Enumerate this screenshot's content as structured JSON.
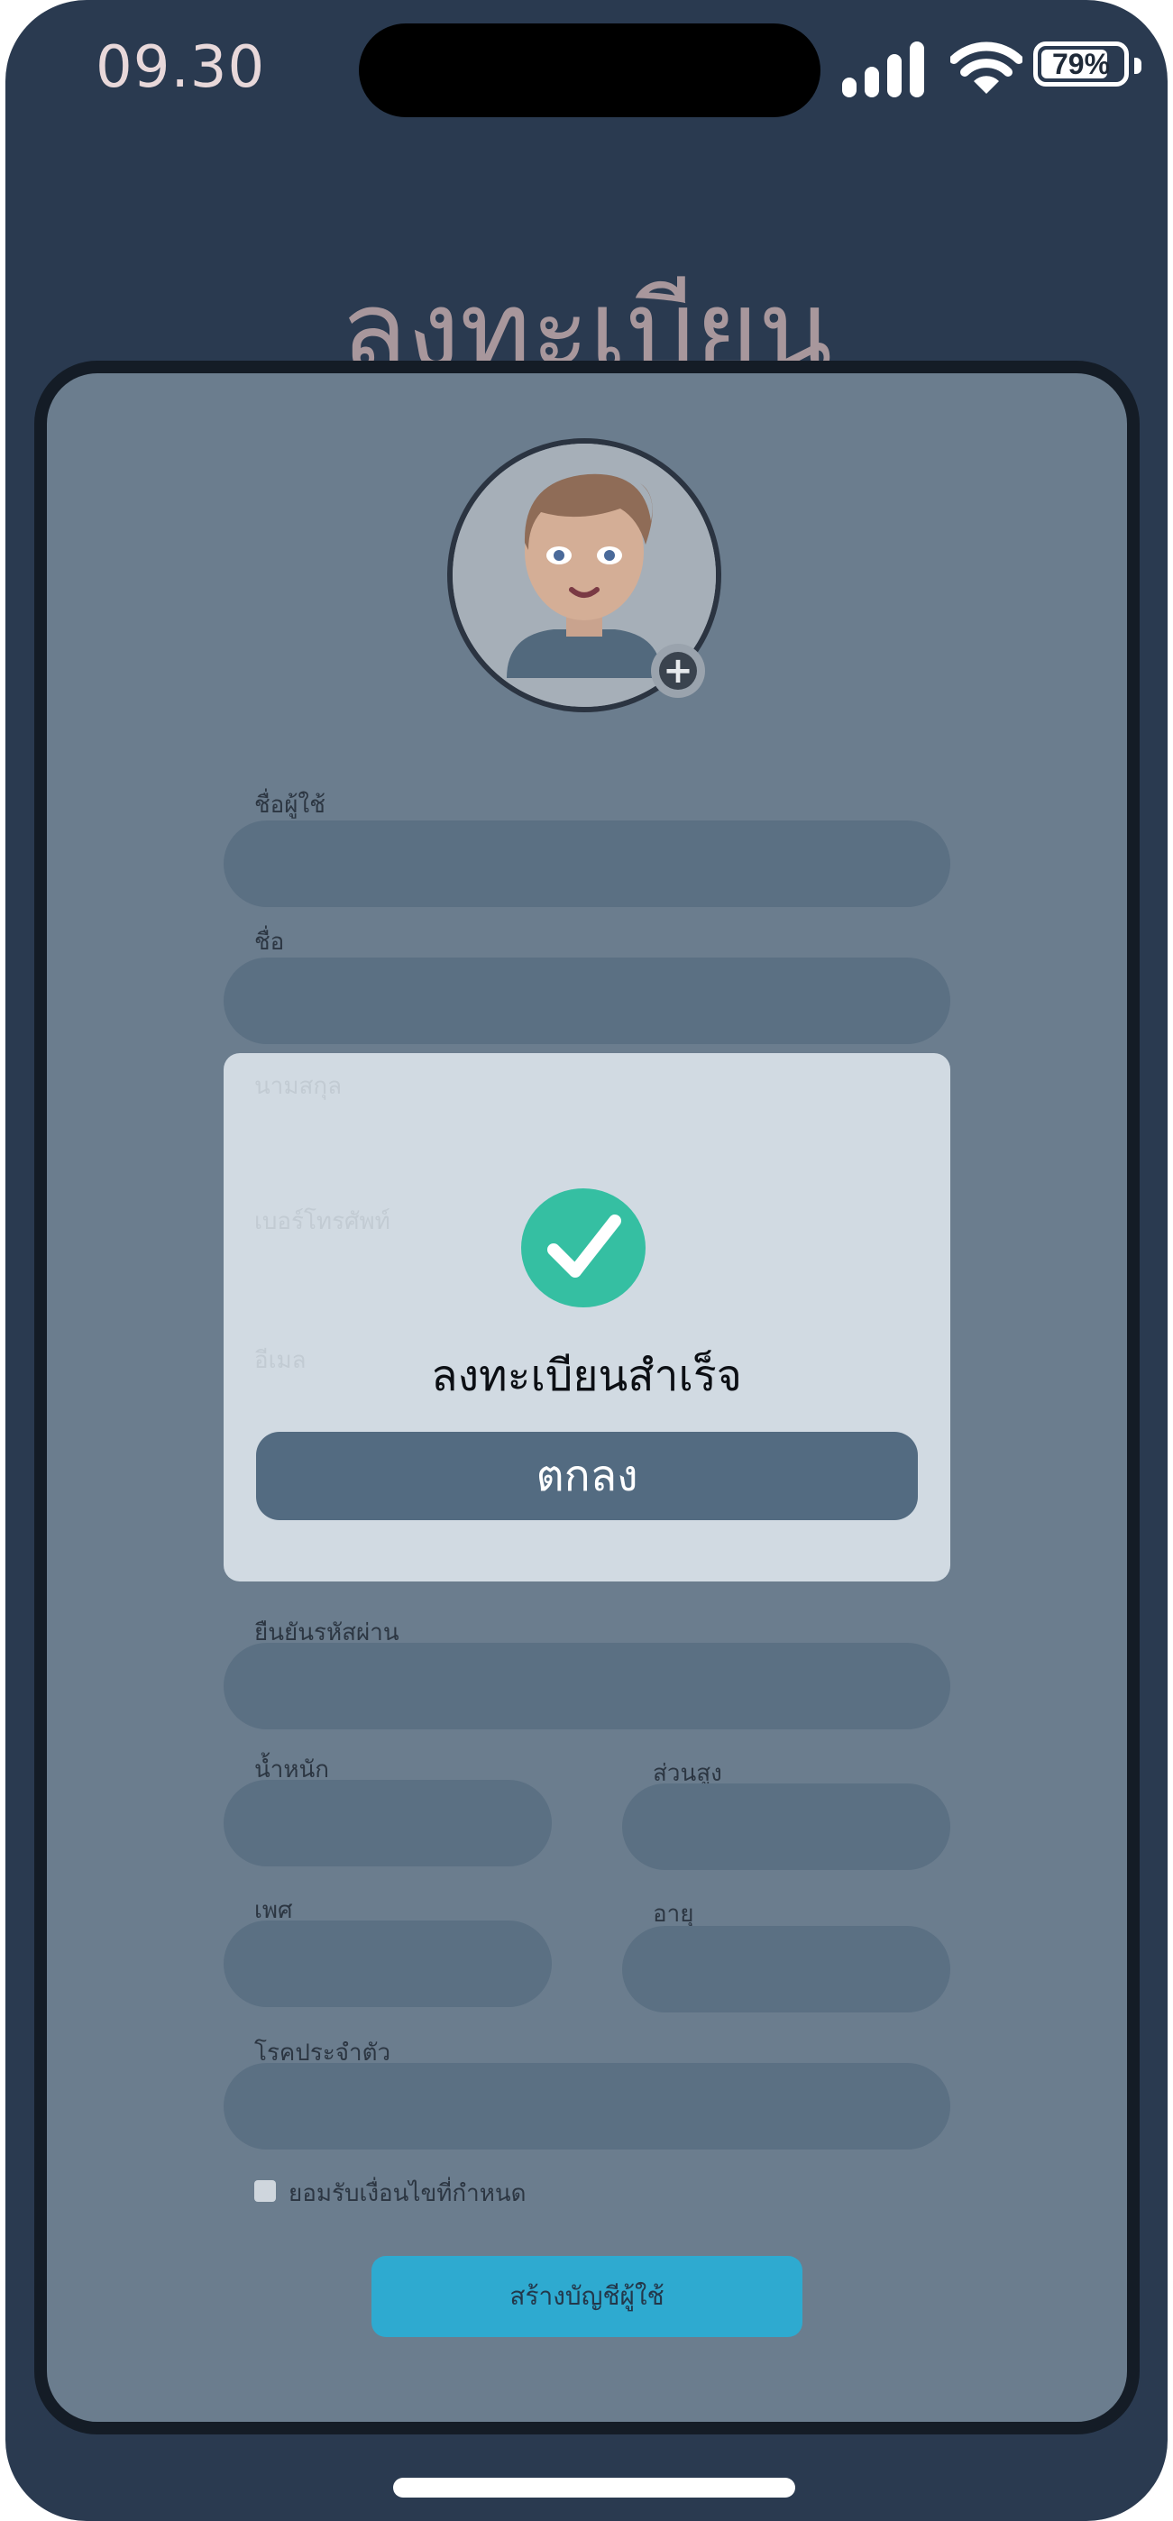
{
  "status_bar": {
    "time": "09.30",
    "battery": "79%",
    "battery_level": 0.79
  },
  "page": {
    "title": "ลงทะเบียน"
  },
  "profile": {
    "avatar_icon": "user-avatar-icon",
    "add_icon": "plus-icon",
    "add_symbol": "+"
  },
  "form": {
    "username_label": "ชื่อผู้ใช้",
    "firstname_label": "ชื่อ",
    "lastname_label": "นามสกุล",
    "phone_label": "เบอร์โทรศัพท์",
    "email_label": "อีเมล",
    "confirm_password_label": "ยืนยันรหัสผ่าน",
    "weight_label": "น้ำหนัก",
    "height_label": "ส่วนสูง",
    "gender_label": "เพศ",
    "age_label": "อายุ",
    "disease_label": "โรคประจำตัว",
    "terms_label": "ยอมรับเงื่อนไขที่กำหนด",
    "terms_checked": false,
    "create_button": "สร้างบัญชีผู้ใช้"
  },
  "modal": {
    "icon": "check-circle-icon",
    "message": "ลงทะเบียนสำเร็จ",
    "ok_button": "ตกลง"
  },
  "colors": {
    "screen_bg": "#2a3a50",
    "card_bg": "#6b7d8e",
    "field_bg": "#5b7083",
    "modal_bg": "#d1dae2",
    "success_green": "#35bfa2",
    "ok_button_bg": "#536b81",
    "create_button_bg": "#2eaad0"
  }
}
